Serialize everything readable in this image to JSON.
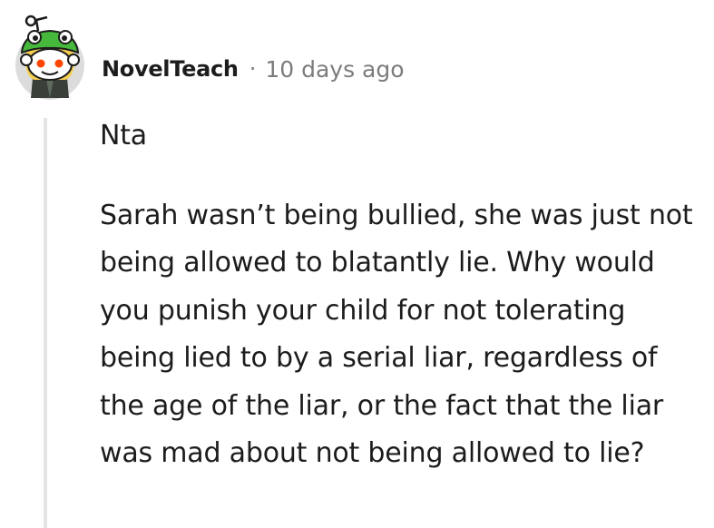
{
  "comment": {
    "author": "NovelTeach",
    "separator": "·",
    "timestamp": "10 days ago",
    "avatar_icon": "snoo-avatar-icon",
    "paragraphs": [
      "Nta",
      "Sarah wasn’t being bullied, she was just not being allowed to blatantly lie. Why would you punish your child for not tolerating being lied to by a serial liar, regardless of the age of the liar, or the fact that the liar was mad about not being allowed to lie?"
    ]
  },
  "colors": {
    "text": "#1c1c1c",
    "meta": "#7c7c7c",
    "thread_line": "#e5e5e5",
    "avatar_bg": "#dcdcdc",
    "hat_green": "#46b83c",
    "eye_red": "#ff4500"
  }
}
